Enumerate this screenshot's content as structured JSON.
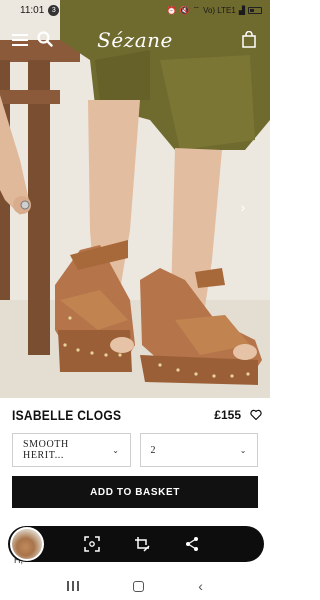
{
  "status_bar": {
    "time": "11:01",
    "notification_count": "3",
    "network": "Vo) LTE1",
    "battery_percent": "",
    "icons": [
      "alarm-icon",
      "mute-icon",
      "wifi-icon",
      "signal-icon",
      "battery-icon"
    ]
  },
  "header": {
    "logo": "Sézane",
    "icons": [
      "menu-icon",
      "search-icon",
      "shopping-bag-icon"
    ]
  },
  "gallery": {
    "next_arrow": "›"
  },
  "product": {
    "name": "ISABELLE CLOGS",
    "price": "£155",
    "wishlist_icon": "heart-icon"
  },
  "options": {
    "color_selected": "SMOOTH HERIT...",
    "size_selected": "2",
    "chevron": "⌄"
  },
  "actions": {
    "add_to_basket": "ADD TO BASKET"
  },
  "screenshot_toolbar": {
    "icons": [
      "scan-icon",
      "crop-edit-icon",
      "share-icon"
    ]
  },
  "partial_text": "H,",
  "colors": {
    "button_bg": "#111111",
    "toolbar_bg": "#0d0d0d",
    "border": "#cfcfcf",
    "leather": "#a8693a"
  }
}
